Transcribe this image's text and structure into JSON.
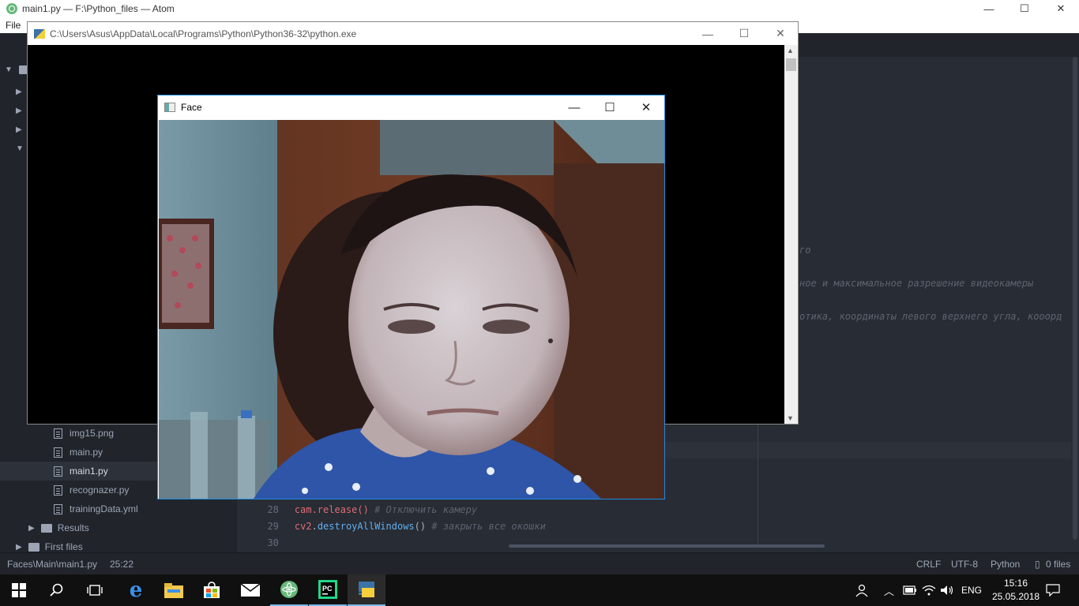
{
  "atom": {
    "title": "main1.py — F:\\Python_files — Atom",
    "menu": [
      "File"
    ],
    "tree": {
      "files": [
        "img15.png",
        "main.py",
        "main1.py",
        "recognazer.py",
        "trainingData.yml"
      ],
      "folders": [
        "Results",
        "First files"
      ],
      "selected": "main1.py"
    },
    "editor": {
      "fragments": [
        "го",
        "ное и максимальное разрешение видеокамеры",
        "отика, координаты левого верхнего угла, кооорд"
      ],
      "lines": [
        {
          "num": "28",
          "code": "cam.release()",
          "comment": "# Отключить камеру"
        },
        {
          "num": "29",
          "code_fn_obj": "cv2",
          "code_fn": "destroyAllWindows",
          "code_tail": "()",
          "comment": "# закрыть все окошки"
        },
        {
          "num": "30",
          "code": "",
          "comment": ""
        }
      ]
    },
    "status": {
      "path": "Faces\\Main\\main1.py",
      "position": "25:22",
      "line_ending": "CRLF",
      "encoding": "UTF-8",
      "grammar": "Python",
      "files": "0 files"
    }
  },
  "console": {
    "title": "C:\\Users\\Asus\\AppData\\Local\\Programs\\Python\\Python36-32\\python.exe"
  },
  "face_window": {
    "title": "Face"
  },
  "taskbar": {
    "language": "ENG",
    "time": "15:16",
    "date": "25.05.2018"
  }
}
